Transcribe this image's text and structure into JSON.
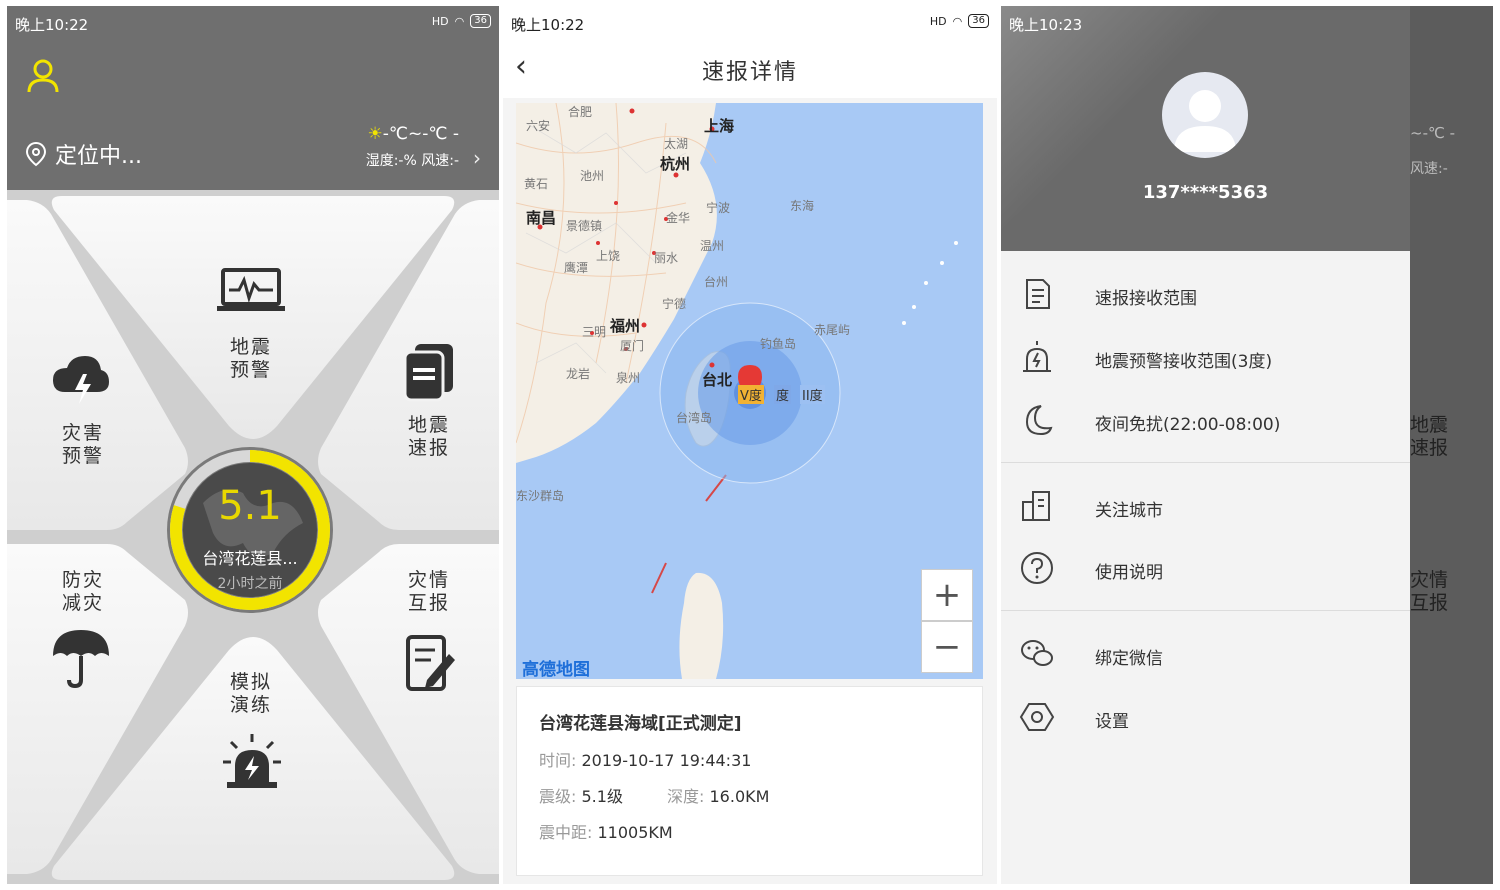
{
  "status": {
    "p1_time": "晚上10:22",
    "p2_time": "晚上10:22",
    "p3_time": "晚上10:23",
    "signal": "HD",
    "battery": "36"
  },
  "home": {
    "location": "定位中...",
    "temp": "-℃~-℃  -",
    "weather_meta": "湿度:-%  风速:-",
    "tiles": {
      "warning": "地震\n预警",
      "report": "地震\n速报",
      "disaster": "灾害\n预警",
      "prevent": "防灾\n减灾",
      "mutual": "灾情\n互报",
      "drill": "模拟\n演练"
    },
    "latest": {
      "magnitude": "5.1",
      "place": "台湾花莲县...",
      "ago": "2小时之前",
      "progress": 0.8
    },
    "colors": {
      "accent": "#f2e400",
      "topbar": "#6f6f6f"
    }
  },
  "detail": {
    "title": "速报详情",
    "map": {
      "labels_bold": [
        "上海",
        "杭州",
        "南昌",
        "福州",
        "台北"
      ],
      "labels": [
        "太湖",
        "东海",
        "钓鱼岛",
        "赤尾屿",
        "台湾岛",
        "东沙群岛",
        "宁波",
        "金华",
        "丽水",
        "宁德",
        "厦门",
        "泉州",
        "龙岩",
        "三明",
        "上饶",
        "鹰潭",
        "景德镇",
        "池州",
        "黄石",
        "六安",
        "合肥",
        "温州",
        "台州"
      ],
      "intensity": [
        "V度",
        "度",
        "II度"
      ],
      "brand": "高德地图",
      "zoom_in": "+",
      "zoom_out": "−"
    },
    "event": {
      "title": "台湾花莲县海域[正式测定]",
      "time_label": "时间:",
      "time": "2019-10-17 19:44:31",
      "mag_label": "震级:",
      "mag": "5.1级",
      "depth_label": "深度:",
      "depth": "16.0KM",
      "dist_label": "震中距:",
      "dist": "11005KM"
    }
  },
  "drawer": {
    "phone": "137****5363",
    "items": [
      {
        "label": "速报接收范围",
        "icon": "document-icon"
      },
      {
        "label": "地震预警接收范围(3度)",
        "icon": "alarm-icon"
      },
      {
        "label": "夜间免扰(22:00-08:00)",
        "icon": "moon-icon"
      },
      {
        "label": "关注城市",
        "icon": "building-icon"
      },
      {
        "label": "使用说明",
        "icon": "help-icon"
      },
      {
        "label": "绑定微信",
        "icon": "wechat-icon"
      },
      {
        "label": "设置",
        "icon": "settings-icon"
      }
    ],
    "peek": {
      "temp": "~-℃  -",
      "wind": "风速:-",
      "report": "地震\n速报",
      "mutual": "灾情\n互报"
    }
  }
}
